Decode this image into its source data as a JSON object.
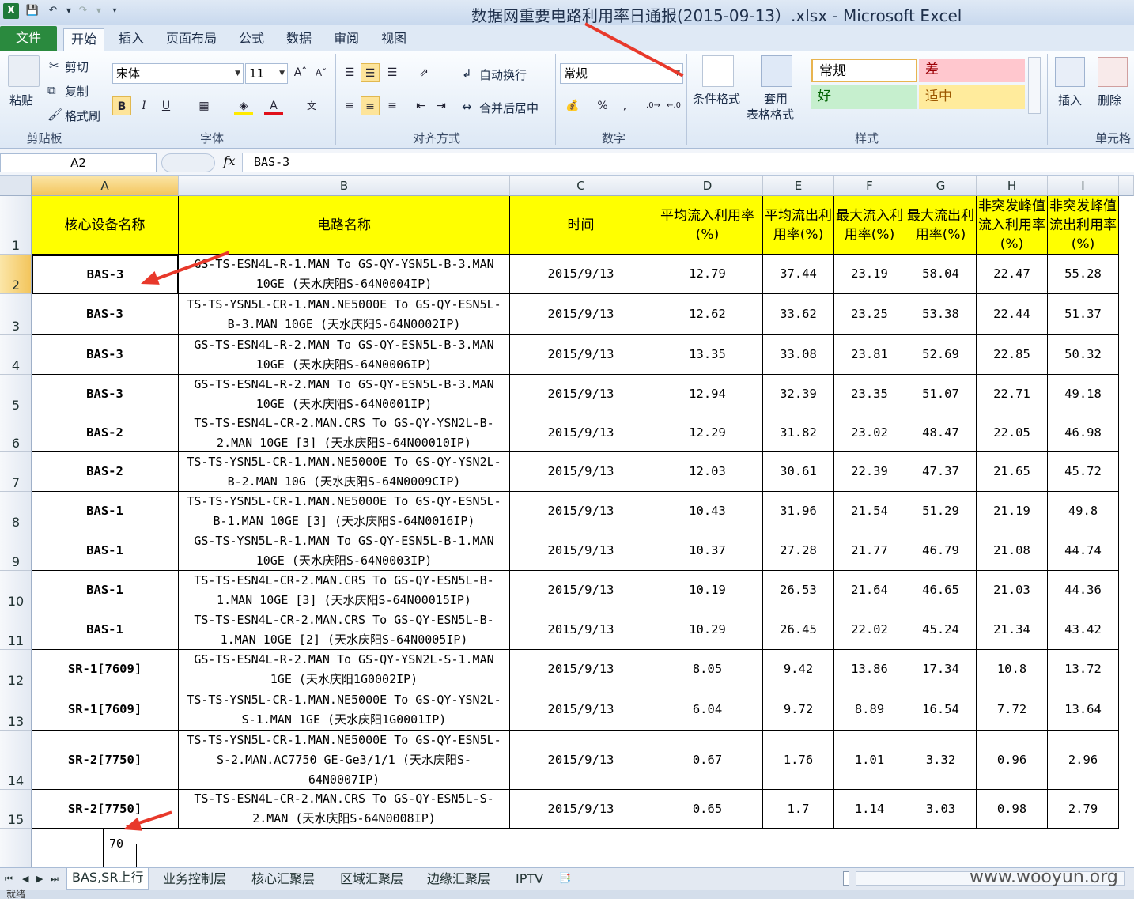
{
  "window": {
    "title": "数据网重要电路利用率日通报(2015-09-13）.xlsx - Microsoft Excel"
  },
  "ribbon_tabs": [
    "文件",
    "开始",
    "插入",
    "页面布局",
    "公式",
    "数据",
    "审阅",
    "视图"
  ],
  "ribbon": {
    "clipboard": {
      "paste": "粘贴",
      "cut": "剪切",
      "copy": "复制",
      "format_painter": "格式刷",
      "label": "剪贴板"
    },
    "font": {
      "name": "宋体",
      "size": "11",
      "label": "字体",
      "bold": "B",
      "italic": "I",
      "underline": "U"
    },
    "alignment": {
      "wrap": "自动换行",
      "merge": "合并后居中",
      "label": "对齐方式"
    },
    "number": {
      "format": "常规",
      "percent": "%",
      "comma": ",",
      "label": "数字"
    },
    "styles": {
      "conditional": "条件格式",
      "table_format_1": "套用",
      "table_format_2": "表格格式",
      "normal": "常规",
      "bad": "差",
      "good": "好",
      "neutral": "适中",
      "label": "样式"
    },
    "cells": {
      "insert": "插入",
      "delete": "删除",
      "label": "单元格"
    }
  },
  "formula_bar": {
    "name_box": "A2",
    "fx": "fx",
    "content": "BAS-3"
  },
  "columns": [
    "A",
    "B",
    "C",
    "D",
    "E",
    "F",
    "G",
    "H",
    "I"
  ],
  "header_row": [
    "核心设备名称",
    "电路名称",
    "时间",
    "平均流入利用率(%)",
    "平均流出利用率(%)",
    "最大流入利用率(%)",
    "最大流出利用率(%)",
    "非突发峰值流入利用率(%)",
    "非突发峰值流出利用率(%)"
  ],
  "rows": [
    {
      "n": "2",
      "device": "BAS-3",
      "circuit": "GS-TS-ESN4L-R-1.MAN To GS-QY-YSN5L-B-3.MAN 10GE (天水庆阳S-64N0004IP)",
      "time": "2015/9/13",
      "d": "12.79",
      "e": "37.44",
      "f": "23.19",
      "g": "58.04",
      "h": "22.47",
      "i": "55.28"
    },
    {
      "n": "3",
      "device": "BAS-3",
      "circuit": "TS-TS-YSN5L-CR-1.MAN.NE5000E To GS-QY-ESN5L-B-3.MAN 10GE (天水庆阳S-64N0002IP)",
      "time": "2015/9/13",
      "d": "12.62",
      "e": "33.62",
      "f": "23.25",
      "g": "53.38",
      "h": "22.44",
      "i": "51.37"
    },
    {
      "n": "4",
      "device": "BAS-3",
      "circuit": "GS-TS-ESN4L-R-2.MAN To GS-QY-ESN5L-B-3.MAN 10GE (天水庆阳S-64N0006IP)",
      "time": "2015/9/13",
      "d": "13.35",
      "e": "33.08",
      "f": "23.81",
      "g": "52.69",
      "h": "22.85",
      "i": "50.32"
    },
    {
      "n": "5",
      "device": "BAS-3",
      "circuit": "GS-TS-ESN4L-R-2.MAN To GS-QY-ESN5L-B-3.MAN 10GE (天水庆阳S-64N0001IP)",
      "time": "2015/9/13",
      "d": "12.94",
      "e": "32.39",
      "f": "23.35",
      "g": "51.07",
      "h": "22.71",
      "i": "49.18"
    },
    {
      "n": "6",
      "device": "BAS-2",
      "circuit": "TS-TS-ESN4L-CR-2.MAN.CRS To GS-QY-YSN2L-B-2.MAN 10GE [3] (天水庆阳S-64N00010IP)",
      "time": "2015/9/13",
      "d": "12.29",
      "e": "31.82",
      "f": "23.02",
      "g": "48.47",
      "h": "22.05",
      "i": "46.98"
    },
    {
      "n": "7",
      "device": "BAS-2",
      "circuit": "TS-TS-YSN5L-CR-1.MAN.NE5000E To GS-QY-YSN2L-B-2.MAN 10G (天水庆阳S-64N0009CIP)",
      "time": "2015/9/13",
      "d": "12.03",
      "e": "30.61",
      "f": "22.39",
      "g": "47.37",
      "h": "21.65",
      "i": "45.72"
    },
    {
      "n": "8",
      "device": "BAS-1",
      "circuit": "TS-TS-YSN5L-CR-1.MAN.NE5000E To GS-QY-ESN5L-B-1.MAN 10GE [3] (天水庆阳S-64N0016IP)",
      "time": "2015/9/13",
      "d": "10.43",
      "e": "31.96",
      "f": "21.54",
      "g": "51.29",
      "h": "21.19",
      "i": "49.8"
    },
    {
      "n": "9",
      "device": "BAS-1",
      "circuit": "GS-TS-YSN5L-R-1.MAN To GS-QY-ESN5L-B-1.MAN 10GE (天水庆阳S-64N0003IP)",
      "time": "2015/9/13",
      "d": "10.37",
      "e": "27.28",
      "f": "21.77",
      "g": "46.79",
      "h": "21.08",
      "i": "44.74"
    },
    {
      "n": "10",
      "device": "BAS-1",
      "circuit": "TS-TS-ESN4L-CR-2.MAN.CRS To GS-QY-ESN5L-B-1.MAN 10GE [3] (天水庆阳S-64N00015IP)",
      "time": "2015/9/13",
      "d": "10.19",
      "e": "26.53",
      "f": "21.64",
      "g": "46.65",
      "h": "21.03",
      "i": "44.36"
    },
    {
      "n": "11",
      "device": "BAS-1",
      "circuit": "TS-TS-ESN4L-CR-2.MAN.CRS To GS-QY-ESN5L-B-1.MAN 10GE [2] (天水庆阳S-64N0005IP)",
      "time": "2015/9/13",
      "d": "10.29",
      "e": "26.45",
      "f": "22.02",
      "g": "45.24",
      "h": "21.34",
      "i": "43.42"
    },
    {
      "n": "12",
      "device": "SR-1[7609]",
      "circuit": "GS-TS-ESN4L-R-2.MAN To GS-QY-YSN2L-S-1.MAN 1GE (天水庆阳1G0002IP)",
      "time": "2015/9/13",
      "d": "8.05",
      "e": "9.42",
      "f": "13.86",
      "g": "17.34",
      "h": "10.8",
      "i": "13.72"
    },
    {
      "n": "13",
      "device": "SR-1[7609]",
      "circuit": "TS-TS-YSN5L-CR-1.MAN.NE5000E To GS-QY-YSN2L-S-1.MAN 1GE (天水庆阳1G0001IP)",
      "time": "2015/9/13",
      "d": "6.04",
      "e": "9.72",
      "f": "8.89",
      "g": "16.54",
      "h": "7.72",
      "i": "13.64"
    },
    {
      "n": "14",
      "device": "SR-2[7750]",
      "circuit": "TS-TS-YSN5L-CR-1.MAN.NE5000E To GS-QY-ESN5L-S-2.MAN.AC7750 GE-Ge3/1/1 (天水庆阳S-64N0007IP)",
      "time": "2015/9/13",
      "d": "0.67",
      "e": "1.76",
      "f": "1.01",
      "g": "3.32",
      "h": "0.96",
      "i": "2.96"
    },
    {
      "n": "15",
      "device": "SR-2[7750]",
      "circuit": "TS-TS-ESN4L-CR-2.MAN.CRS To GS-QY-ESN5L-S-2.MAN (天水庆阳S-64N0008IP)",
      "time": "2015/9/13",
      "d": "0.65",
      "e": "1.7",
      "f": "1.14",
      "g": "3.03",
      "h": "0.98",
      "i": "2.79"
    }
  ],
  "extra_value": "70",
  "sheet_tabs": [
    "BAS,SR上行",
    "业务控制层",
    "核心汇聚层",
    "区域汇聚层",
    "边缘汇聚层",
    "IPTV"
  ],
  "status": "就绪",
  "watermark": "www.wooyun.org"
}
